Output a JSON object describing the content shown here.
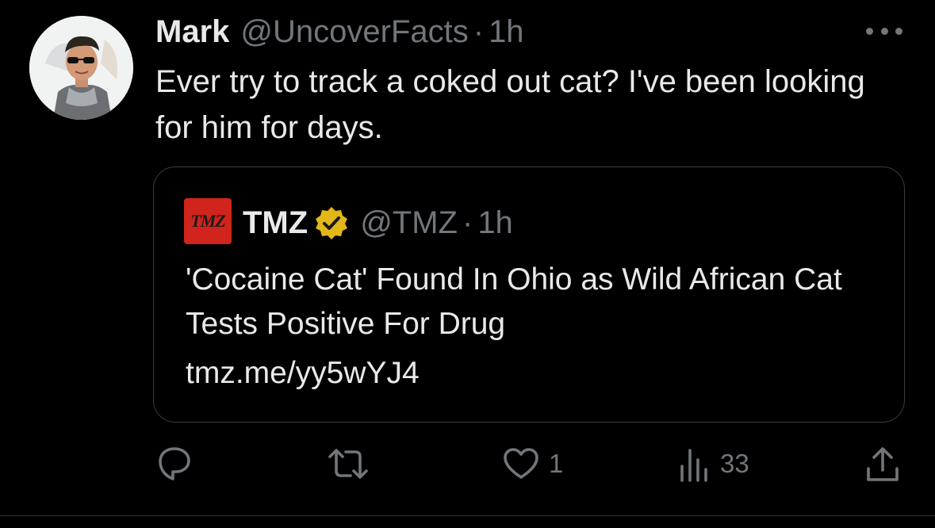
{
  "author": {
    "name": "Mark",
    "handle": "@UncoverFacts",
    "separator": "·",
    "time": "1h",
    "avatar_icon": "profile-photo"
  },
  "tweet": {
    "text": "Ever try to track a coked out cat? I've been looking for him for days."
  },
  "quoted": {
    "logo_text": "TMZ",
    "name": "TMZ",
    "verified_badge": "gold-verified-badge-icon",
    "handle": "@TMZ",
    "separator": "·",
    "time": "1h",
    "text": "'Cocaine Cat' Found In Ohio as Wild African Cat Tests Positive For Drug",
    "link": "tmz.me/yy5wYJ4"
  },
  "actions": {
    "reply_icon": "reply-icon",
    "retweet_icon": "retweet-icon",
    "like_icon": "heart-icon",
    "like_count": "1",
    "views_icon": "views-icon",
    "views_count": "33",
    "share_icon": "share-icon"
  },
  "colors": {
    "background": "#000000",
    "text_primary": "#e7e9ea",
    "text_secondary": "#71767b",
    "border": "#3a3d40",
    "tmz_red": "#d0241c",
    "verified_gold": "#e2b719"
  }
}
